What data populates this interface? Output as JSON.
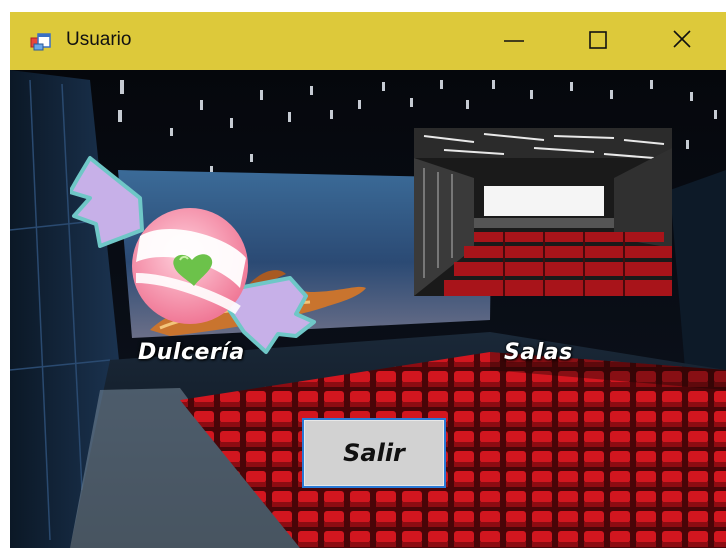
{
  "window": {
    "title": "Usuario",
    "icon": "windows-form-icon",
    "controls": {
      "minimize": "minimize-icon",
      "maximize": "maximize-icon",
      "close": "close-icon"
    }
  },
  "content": {
    "dulceria_label": "Dulcería",
    "salas_label": "Salas",
    "exit_button_label": "Salir"
  },
  "colors": {
    "titlebar": "#ddc93a",
    "seat_red": "#c8141c",
    "button_border": "#2a7ad6"
  }
}
